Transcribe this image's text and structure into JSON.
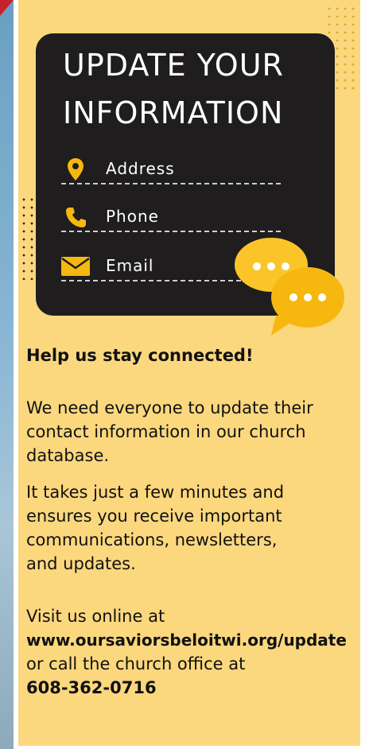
{
  "card": {
    "title_line1": "UPDATE YOUR",
    "title_line2": "INFORMATION",
    "items": [
      {
        "label": "Address",
        "icon": "map-pin-icon"
      },
      {
        "label": "Phone",
        "icon": "phone-icon"
      },
      {
        "label": "Email",
        "icon": "envelope-icon"
      }
    ]
  },
  "body": {
    "headline": "Help us stay connected!",
    "para1": "We need everyone to update their contact information in our church database.",
    "para2": "It takes just a few minutes and ensures you receive important communications, newsletters, and updates.",
    "para3_intro": "Visit us online at",
    "url": "www.oursaviorsbeloitwi.org/update",
    "para3_mid": "or call the church office at",
    "phone": "608-362-0716"
  },
  "colors": {
    "panel": "#fbd77e",
    "card": "#1f1d1e",
    "accent": "#f6b80f"
  }
}
